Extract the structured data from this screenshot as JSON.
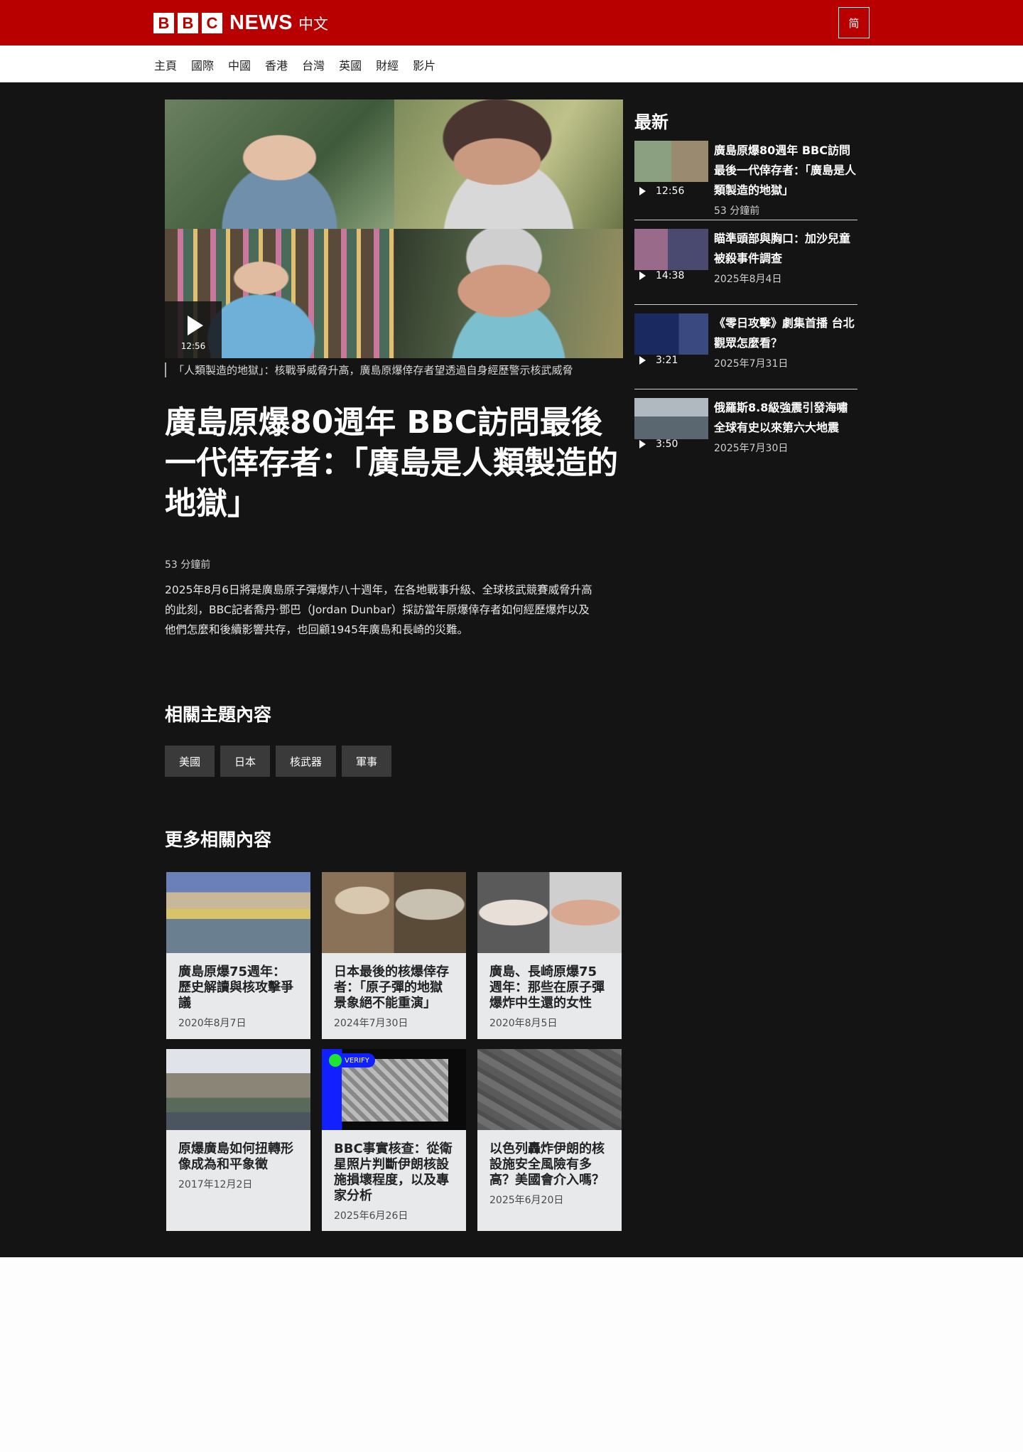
{
  "header": {
    "logo_letters": [
      "B",
      "B",
      "C"
    ],
    "logo_word": "NEWS",
    "logo_lang": "中文",
    "script_toggle": "简",
    "brand_color": "#b80000"
  },
  "nav": {
    "items": [
      "主頁",
      "國際",
      "中國",
      "香港",
      "台灣",
      "英國",
      "財經",
      "影片"
    ]
  },
  "article": {
    "video_duration": "12:56",
    "caption": "「人類製造的地獄」：核戰爭威脅升高，廣島原爆倖存者望透過自身經歷警示核武威脅",
    "headline": "廣島原爆80週年 BBC訪問最後一代倖存者：「廣島是人類製造的地獄」",
    "time": "53 分鐘前",
    "summary": "2025年8月6日將是廣島原子彈爆炸八十週年，在各地戰事升級、全球核武競賽威脅升高的此刻，BBC記者喬丹·鄧巴（Jordan Dunbar）採訪當年原爆倖存者如何經歷爆炸以及他們怎麼和後續影響共存，也回顧1945年廣島和長崎的災難。"
  },
  "related_topics": {
    "title": "相關主題內容",
    "tags": [
      "美國",
      "日本",
      "核武器",
      "軍事"
    ]
  },
  "more": {
    "title": "更多相關內容",
    "cards": [
      {
        "title": "廣島原爆75週年：歷史解讀與核攻擊爭議",
        "date": "2020年8月7日"
      },
      {
        "title": "日本最後的核爆倖存者：「原子彈的地獄景象絕不能重演」",
        "date": "2024年7月30日"
      },
      {
        "title": "廣島、長崎原爆75週年：那些在原子彈爆炸中生還的女性",
        "date": "2020年8月5日"
      },
      {
        "title": "原爆廣島如何扭轉形像成為和平象徵",
        "date": "2017年12月2日"
      },
      {
        "title": "BBC事實核查：從衛星照片判斷伊朗核設施損壞程度，以及專家分析",
        "date": "2025年6月26日",
        "badge": "VERIFY"
      },
      {
        "title": "以色列轟炸伊朗的核設施安全風險有多高？美國會介入嗎？",
        "date": "2025年6月20日"
      }
    ]
  },
  "latest": {
    "title": "最新",
    "items": [
      {
        "title": "廣島原爆80週年 BBC訪問最後一代倖存者：「廣島是人類製造的地獄」",
        "duration": "12:56",
        "date": "53 分鐘前"
      },
      {
        "title": "瞄準頭部與胸口：加沙兒童被殺事件調查",
        "duration": "14:38",
        "date": "2025年8月4日"
      },
      {
        "title": "《零日攻擊》劇集首播 台北觀眾怎麼看？",
        "duration": "3:21",
        "date": "2025年7月31日"
      },
      {
        "title": "俄羅斯8.8級強震引發海嘯 全球有史以來第六大地震",
        "duration": "3:50",
        "date": "2025年7月30日"
      }
    ]
  }
}
